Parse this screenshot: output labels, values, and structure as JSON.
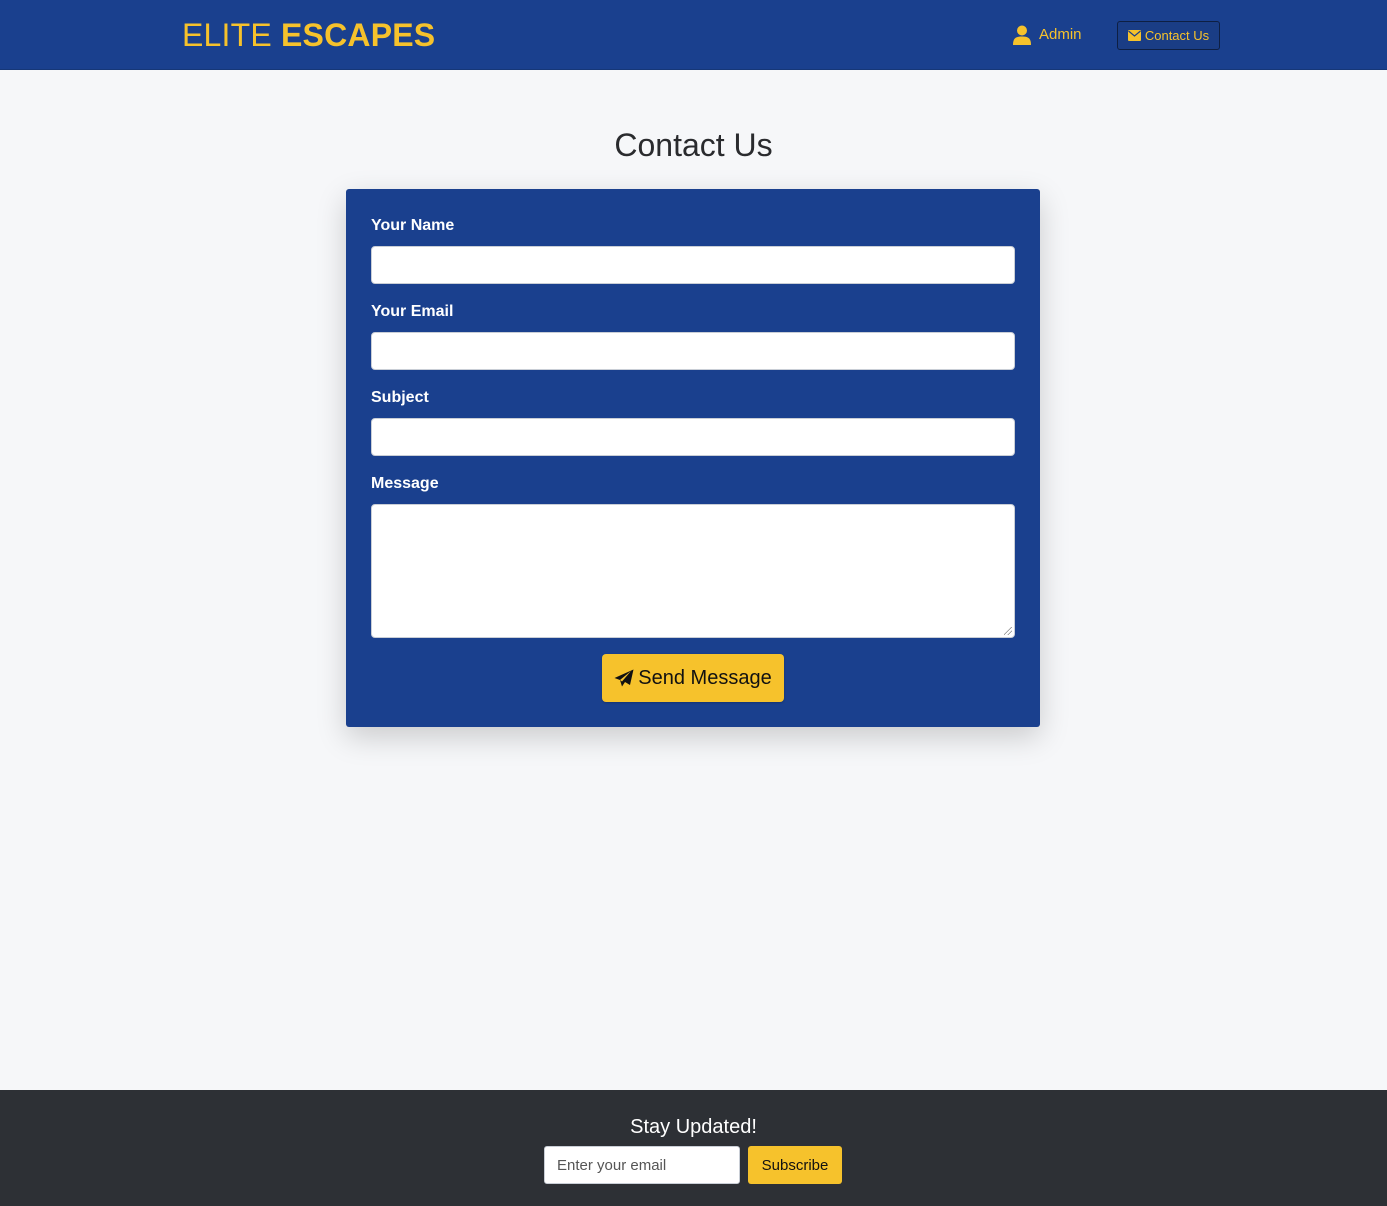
{
  "navbar": {
    "brand_light": "ELITE",
    "brand_bold": "ESCAPES",
    "admin_label": "Admin",
    "contact_label": "Contact Us",
    "accent_color": "#f6c22c",
    "background_color": "#1a408e"
  },
  "page": {
    "title": "Contact Us"
  },
  "form": {
    "name_label": "Your Name",
    "name_value": "",
    "email_label": "Your Email",
    "email_value": "",
    "subject_label": "Subject",
    "subject_value": "",
    "message_label": "Message",
    "message_value": "",
    "send_label": "Send Message"
  },
  "footer": {
    "title": "Stay Updated!",
    "email_placeholder": "Enter your email",
    "subscribe_label": "Subscribe"
  },
  "icons": {
    "admin": "user-icon",
    "contact": "envelope-icon",
    "send": "paper-plane-icon"
  }
}
